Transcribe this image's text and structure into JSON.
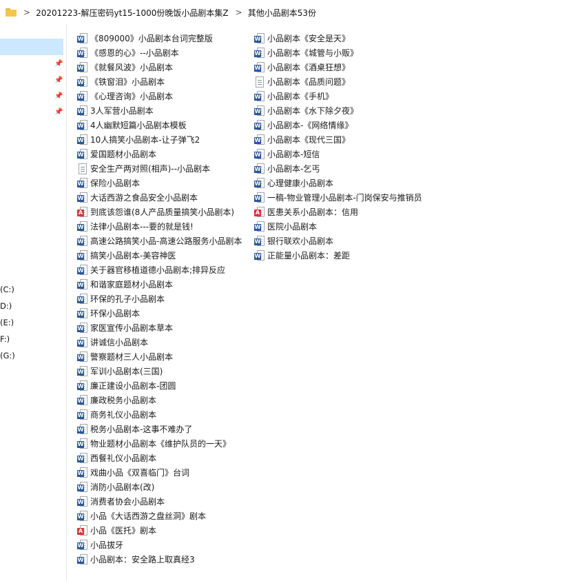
{
  "address": {
    "crumbs": [
      "20201223-解压密码yt15-1000份晚饭小品剧本集Z",
      "其他小品剧本53份"
    ],
    "separator": ">"
  },
  "nav": {
    "drives": [
      "(C:)",
      "D:)",
      "(E:)",
      "F:)",
      "(G:)"
    ]
  },
  "files": [
    {
      "name": "《809000》小品剧本台词完整版",
      "type": "word"
    },
    {
      "name": "《感恩的心》--小品剧本",
      "type": "word"
    },
    {
      "name": "《就餐风波》小品剧本",
      "type": "word"
    },
    {
      "name": "《铁窗泪》小品剧本",
      "type": "word"
    },
    {
      "name": "《心理咨询》小品剧本",
      "type": "word"
    },
    {
      "name": "3人军营小品剧本",
      "type": "word"
    },
    {
      "name": "4人幽默短篇小品剧本模板",
      "type": "word"
    },
    {
      "name": "10人搞笑小品剧本-让子弹飞2",
      "type": "word"
    },
    {
      "name": "爱国题材小品剧本",
      "type": "word"
    },
    {
      "name": "安全生产两对照(相声)--小品剧本",
      "type": "txt"
    },
    {
      "name": "保险小品剧本",
      "type": "word"
    },
    {
      "name": "大话西游之食品安全小品剧本",
      "type": "word"
    },
    {
      "name": "到底该怨谁(8人产品质量搞笑小品剧本)",
      "type": "pdf"
    },
    {
      "name": "法律小品剧本---要的就是钱!",
      "type": "word"
    },
    {
      "name": "高速公路搞笑小品-高速公路服务小品剧本",
      "type": "word"
    },
    {
      "name": "搞笑小品剧本-美容神医",
      "type": "word"
    },
    {
      "name": "关于器官移植道德小品剧本;排异反应",
      "type": "word"
    },
    {
      "name": "和谐家庭题材小品剧本",
      "type": "word"
    },
    {
      "name": "环保的孔子小品剧本",
      "type": "word"
    },
    {
      "name": "环保小品剧本",
      "type": "word"
    },
    {
      "name": "家医宣传小品剧本草本",
      "type": "word"
    },
    {
      "name": "讲诚信小品剧本",
      "type": "word"
    },
    {
      "name": "警察题材三人小品剧本",
      "type": "word"
    },
    {
      "name": "军训小品剧本(三国)",
      "type": "word"
    },
    {
      "name": "廉正建设小品剧本-团圆",
      "type": "word"
    },
    {
      "name": "廉政税务小品剧本",
      "type": "word"
    },
    {
      "name": "商务礼仪小品剧本",
      "type": "word"
    },
    {
      "name": "税务小品剧本-这事不难办了",
      "type": "word"
    },
    {
      "name": "物业题材小品剧本《维护队员的一天》",
      "type": "word"
    },
    {
      "name": "西餐礼仪小品剧本",
      "type": "word"
    },
    {
      "name": "戏曲小品《双喜临门》台词",
      "type": "word"
    },
    {
      "name": "消防小品剧本(改)",
      "type": "word"
    },
    {
      "name": "消费者协会小品剧本",
      "type": "word"
    },
    {
      "name": "小品《大话西游之盘丝洞》剧本",
      "type": "word"
    },
    {
      "name": "小品《医托》剧本",
      "type": "pdf"
    },
    {
      "name": "小品拔牙",
      "type": "word"
    },
    {
      "name": "小品剧本：安全路上取真经3",
      "type": "word"
    },
    {
      "name": "小品剧本《安全是天》",
      "type": "word"
    },
    {
      "name": "小品剧本《城管与小贩》",
      "type": "word"
    },
    {
      "name": "小品剧本《酒桌狂想》",
      "type": "word"
    },
    {
      "name": "小品剧本《品质问题》",
      "type": "txt"
    },
    {
      "name": "小品剧本《手机》",
      "type": "word"
    },
    {
      "name": "小品剧本《水下除夕夜》",
      "type": "word"
    },
    {
      "name": "小品剧本-《网络情缘》",
      "type": "word"
    },
    {
      "name": "小品剧本《现代三国》",
      "type": "word"
    },
    {
      "name": "小品剧本-短信",
      "type": "word"
    },
    {
      "name": "小品剧本-乞丐",
      "type": "word"
    },
    {
      "name": "心理健康小品剧本",
      "type": "word"
    },
    {
      "name": "一稿-物业管理小品剧本-门岗保安与推销员",
      "type": "word"
    },
    {
      "name": "医患关系小品剧本：信用",
      "type": "pdf"
    },
    {
      "name": "医院小品剧本",
      "type": "word"
    },
    {
      "name": "银行联欢小品剧本",
      "type": "word"
    },
    {
      "name": "正能量小品剧本：差距",
      "type": "word"
    }
  ]
}
